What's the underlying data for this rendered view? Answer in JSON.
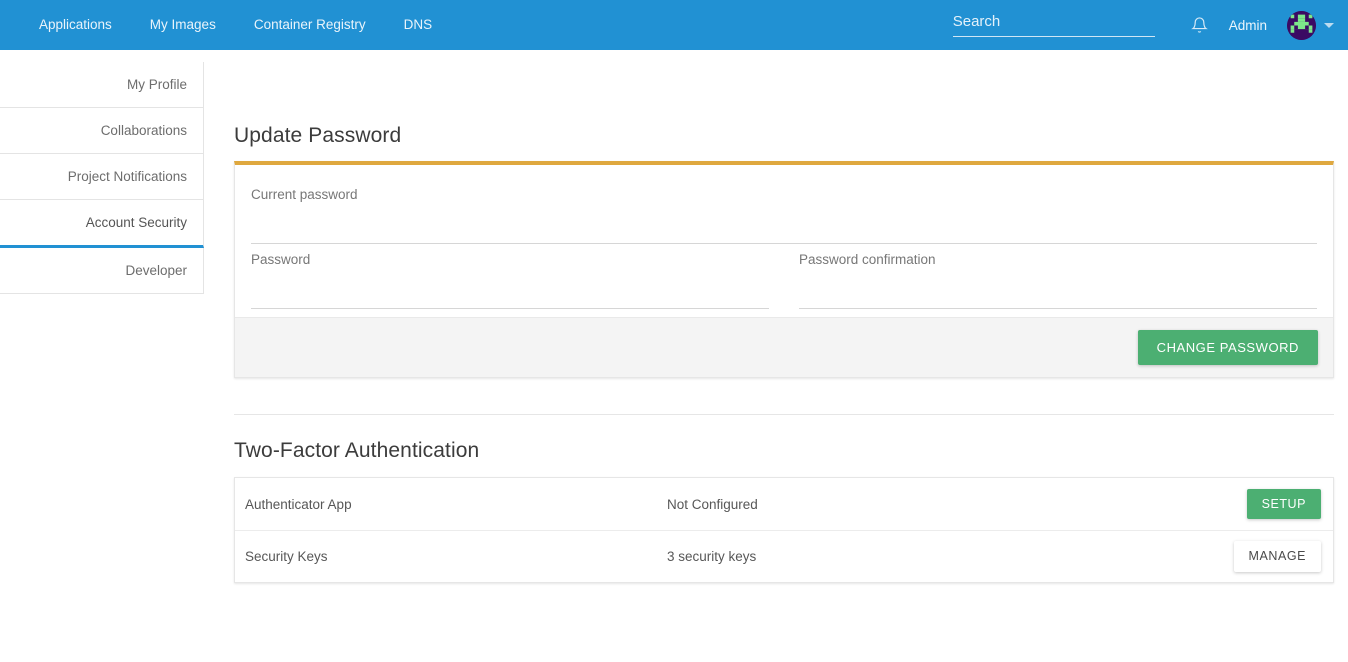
{
  "topnav": {
    "links": [
      {
        "label": "Applications",
        "name": "nav-applications"
      },
      {
        "label": "My Images",
        "name": "nav-my-images"
      },
      {
        "label": "Container Registry",
        "name": "nav-container-registry"
      },
      {
        "label": "DNS",
        "name": "nav-dns"
      }
    ],
    "search": {
      "value": "",
      "placeholder": "Search"
    },
    "notifications_icon": "bell-icon",
    "user_label": "Admin",
    "avatar_icon": "identicon-avatar",
    "caret_icon": "chevron-down-icon",
    "background_color": "#2191d3"
  },
  "sidebar": {
    "items": [
      {
        "label": "My Profile",
        "active": false
      },
      {
        "label": "Collaborations",
        "active": false
      },
      {
        "label": "Project Notifications",
        "active": false
      },
      {
        "label": "Account Security",
        "active": true
      },
      {
        "label": "Developer",
        "active": false
      }
    ],
    "active_color": "#2191d3"
  },
  "update_password": {
    "title": "Update Password",
    "accent_color": "#dfa83f",
    "fields": {
      "current": {
        "label": "Current password",
        "value": "",
        "placeholder": ""
      },
      "password": {
        "label": "Password",
        "value": "",
        "placeholder": ""
      },
      "confirmation": {
        "label": "Password confirmation",
        "value": "",
        "placeholder": ""
      }
    },
    "submit_label": "CHANGE PASSWORD",
    "submit_color": "#4caf72"
  },
  "two_factor": {
    "title": "Two-Factor Authentication",
    "rows": [
      {
        "name": "Authenticator App",
        "status": "Not Configured",
        "action": "SETUP",
        "style": "green"
      },
      {
        "name": "Security Keys",
        "status": "3 security keys",
        "action": "MANAGE",
        "style": "white"
      }
    ]
  }
}
